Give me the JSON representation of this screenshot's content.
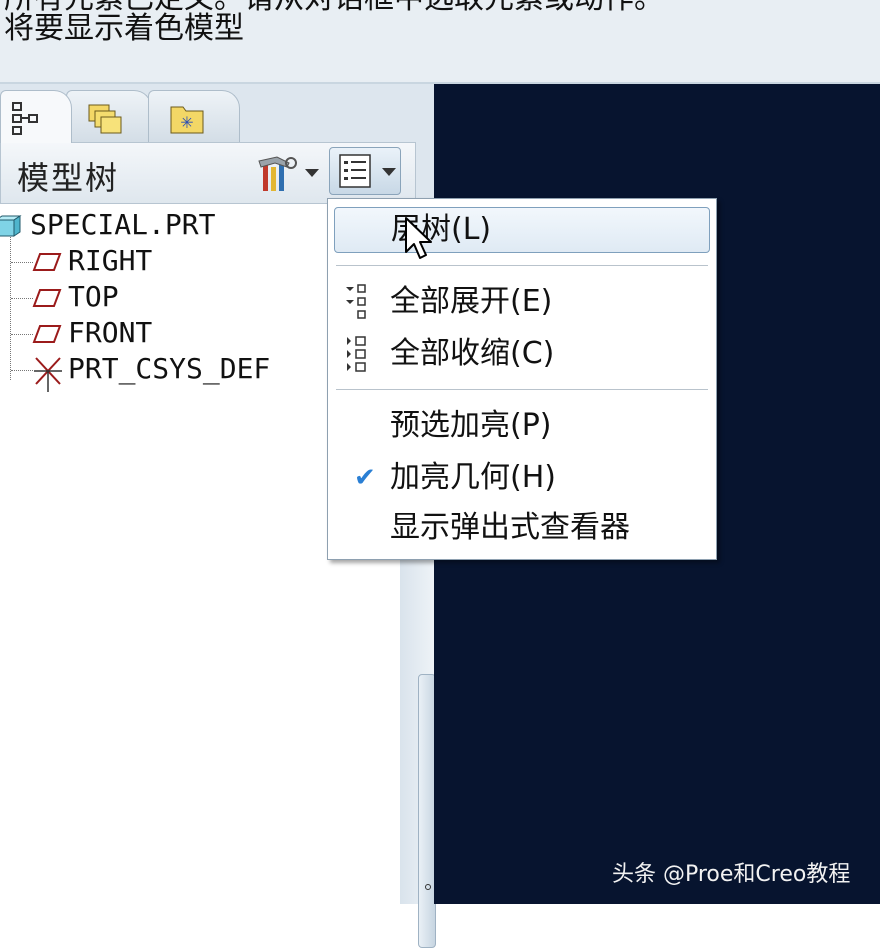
{
  "message": {
    "line1": "所有元素已定义。请从对话框中选取元素或动作。",
    "line2": "将要显示着色模型"
  },
  "tabs": [
    {
      "icon": "model-tree-icon",
      "active": true
    },
    {
      "icon": "folder-browser-icon",
      "active": false
    },
    {
      "icon": "favorites-folder-icon",
      "active": false
    }
  ],
  "tree_header": {
    "title": "模型树",
    "tools_icon": "settings-tools-icon",
    "show_icon": "show-menu-icon"
  },
  "tree": {
    "root": "SPECIAL.PRT",
    "items": [
      "RIGHT",
      "TOP",
      "FRONT",
      "PRT_CSYS_DEF"
    ]
  },
  "menu": {
    "items": [
      {
        "label": "层树(L)",
        "hover": true
      },
      {
        "label": "全部展开(E)",
        "icon": "expand-all-icon"
      },
      {
        "label": "全部收缩(C)",
        "icon": "collapse-all-icon"
      },
      {
        "label": "预选加亮(P)"
      },
      {
        "label": "加亮几何(H)",
        "checked": true
      },
      {
        "label": "显示弹出式查看器"
      }
    ]
  },
  "watermark": "头条 @Proe和Creo教程",
  "colors": {
    "viewport_bg": "#07142f",
    "check": "#2a7fd4",
    "plane_icon": "#9b1b1b"
  }
}
